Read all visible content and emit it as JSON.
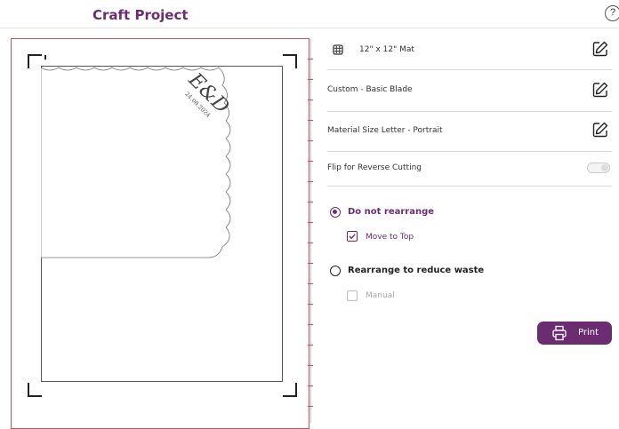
{
  "header": {
    "title": "Craft Project",
    "help_glyph": "?"
  },
  "preview": {
    "monogram": "E&D",
    "date": "24.08.2024"
  },
  "settings": {
    "mat": {
      "label": "12\" x 12\" Mat",
      "icon": "grid-icon"
    },
    "blade": {
      "label": "Custom - Basic Blade"
    },
    "material_size": {
      "label": "Material Size  Letter - Portrait"
    },
    "flip": {
      "label": "Flip for Reverse Cutting",
      "enabled": false
    }
  },
  "arrange": {
    "option1": {
      "label": "Do not rearrange",
      "selected": true
    },
    "move_to_top": {
      "label": "Move to Top",
      "checked": true
    },
    "option2": {
      "label": "Rearrange to reduce waste",
      "selected": false
    },
    "manual": {
      "label": "Manual",
      "checked": false,
      "disabled": true
    }
  },
  "actions": {
    "print_label": "Print"
  },
  "colors": {
    "accent": "#6b2c72",
    "panel_border": "#c9515f"
  }
}
